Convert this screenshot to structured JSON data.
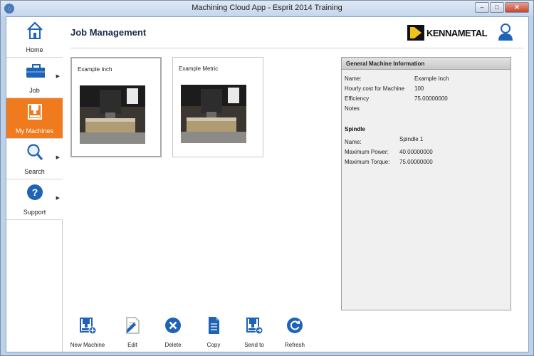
{
  "window": {
    "title": "Machining Cloud App - Esprit 2014 Training",
    "controls": {
      "minimize": "–",
      "maximize": "□",
      "close": "✕"
    }
  },
  "sidebar": {
    "items": [
      {
        "label": "Home",
        "icon": "home-icon",
        "has_submenu": false,
        "active": false
      },
      {
        "label": "Job",
        "icon": "briefcase-icon",
        "has_submenu": true,
        "active": false
      },
      {
        "label": "My Machines",
        "icon": "machine-icon",
        "has_submenu": false,
        "active": true
      },
      {
        "label": "Search",
        "icon": "magnifier-icon",
        "has_submenu": true,
        "active": false
      },
      {
        "label": "Support",
        "icon": "help-icon",
        "has_submenu": true,
        "active": false
      }
    ]
  },
  "header": {
    "title": "Job Management",
    "brand": "KENNAMETAL",
    "user_icon": "user-icon"
  },
  "machines": [
    {
      "name": "Example Inch",
      "selected": true
    },
    {
      "name": "Example Metric",
      "selected": false
    }
  ],
  "info_panel": {
    "title": "General Machine Information",
    "general": [
      {
        "label": "Name:",
        "value": "Example Inch"
      },
      {
        "label": "Hourly cost for Machine",
        "value": "100"
      },
      {
        "label": "Efficiency",
        "value": "75.00000000"
      },
      {
        "label": "Notes",
        "value": ""
      }
    ],
    "spindle_title": "Spindle",
    "spindle": [
      {
        "label": "Name:",
        "value": "Spindle 1"
      },
      {
        "label": "Maximum Power:",
        "value": "40.00000000"
      },
      {
        "label": "Maximum Torque:",
        "value": "75.00000000"
      }
    ]
  },
  "toolbar": {
    "buttons": [
      {
        "label": "New Machine",
        "icon": "new-machine-icon"
      },
      {
        "label": "Edit",
        "icon": "edit-icon"
      },
      {
        "label": "Delete",
        "icon": "delete-icon"
      },
      {
        "label": "Copy",
        "icon": "copy-icon"
      },
      {
        "label": "Send to",
        "icon": "send-to-icon"
      },
      {
        "label": "Refresh",
        "icon": "refresh-icon"
      }
    ]
  },
  "colors": {
    "accent": "#f07b1e",
    "icon_blue": "#1e63b6",
    "brand_yellow": "#f2c21b"
  }
}
